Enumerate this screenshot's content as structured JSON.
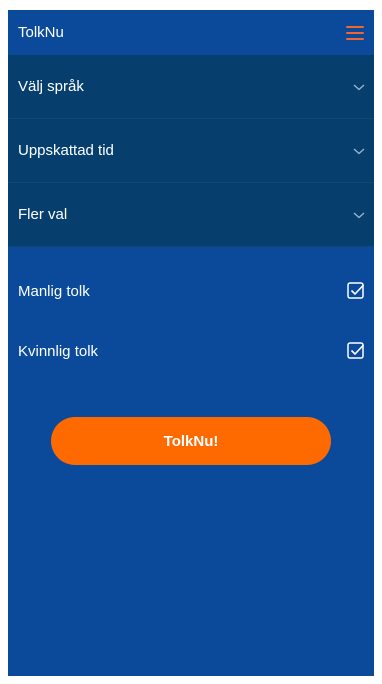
{
  "app": {
    "title": "TolkNu",
    "menu_icon": "hamburger-menu-icon",
    "colors": {
      "background": "#0b4a9a",
      "dropdown_background": "#063f6e",
      "accent": "#ff6a00",
      "menu_accent": "#f0672b"
    }
  },
  "dropdowns": [
    {
      "label": "Välj språk",
      "icon": "chevron-down-icon"
    },
    {
      "label": "Uppskattad tid",
      "icon": "chevron-down-icon"
    },
    {
      "label": "Fler val",
      "icon": "chevron-down-icon"
    }
  ],
  "options": [
    {
      "label": "Manlig tolk",
      "checked": true,
      "icon": "checkbox-checked-icon"
    },
    {
      "label": "Kvinnlig tolk",
      "checked": true,
      "icon": "checkbox-checked-icon"
    }
  ],
  "cta": {
    "label": "TolkNu!"
  }
}
